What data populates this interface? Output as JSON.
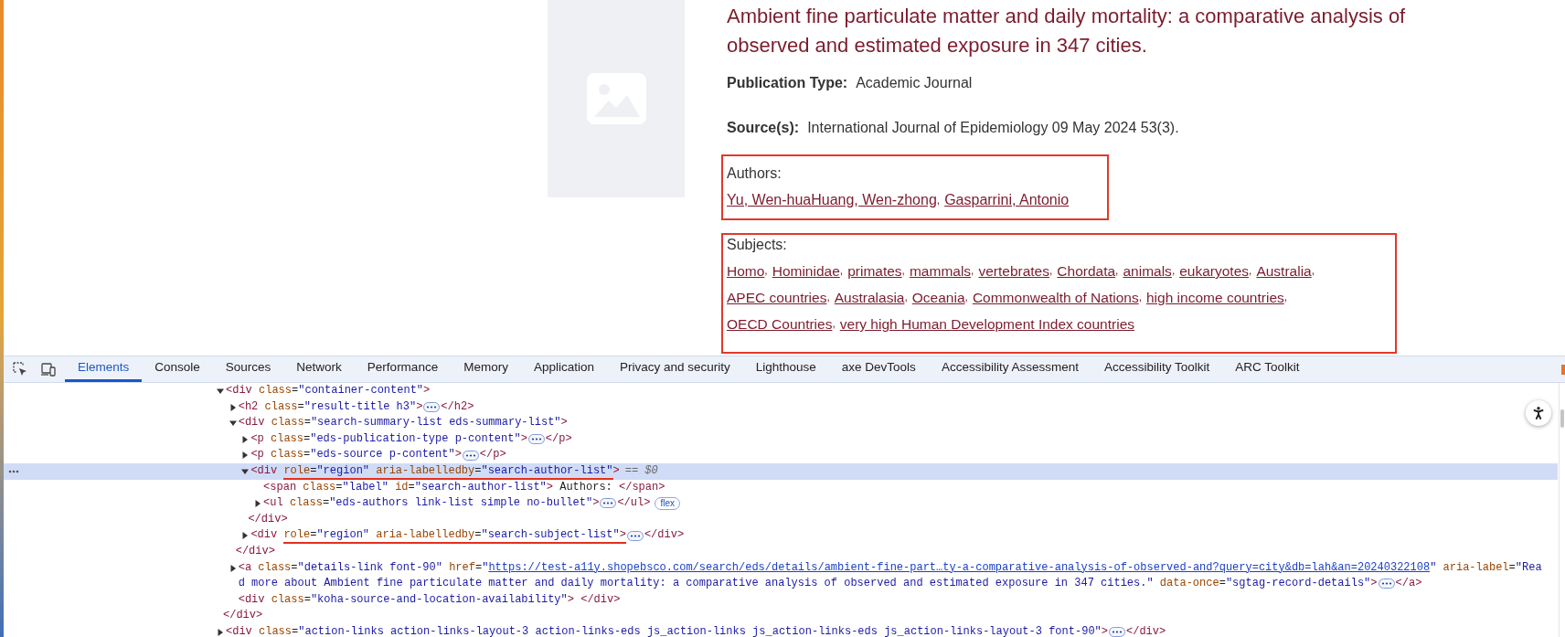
{
  "page": {
    "title": "Ambient fine particulate matter and daily mortality: a comparative analysis of observed and estimated exposure in 347 cities.",
    "fields": [
      {
        "label": "Publication Type:",
        "value": "Academic Journal"
      },
      {
        "label": "Source(s):",
        "value": "International Journal of Epidemiology 09 May 2024 53(3)."
      }
    ],
    "authors": {
      "label": "Authors:",
      "highlighted": true,
      "items": [
        {
          "name": "Yu, Wen-hua"
        },
        {
          "name": "Huang, Wen-zhong",
          "after": ","
        },
        {
          "name": "Gasparrini, Antonio"
        }
      ]
    },
    "subjects": {
      "label": "Subjects:",
      "highlighted": true,
      "items": [
        {
          "name": "Homo",
          "after": ","
        },
        {
          "name": "Hominidae",
          "after": ","
        },
        {
          "name": "primates",
          "after": ","
        },
        {
          "name": "mammals",
          "after": ","
        },
        {
          "name": "vertebrates",
          "after": ","
        },
        {
          "name": "Chordata",
          "after": ","
        },
        {
          "name": "animals",
          "after": ","
        },
        {
          "name": "eukaryotes",
          "after": ","
        },
        {
          "name": "Australia",
          "after": ","
        },
        {
          "name": "APEC countries",
          "after": ","
        },
        {
          "name": "Australasia",
          "after": ","
        },
        {
          "name": "Oceania",
          "after": ","
        },
        {
          "name": "Commonwealth of Nations",
          "after": ","
        },
        {
          "name": "high income countries",
          "after": ","
        },
        {
          "name": "OECD Countries",
          "after": ","
        },
        {
          "name": "very high Human Development Index countries"
        }
      ]
    }
  },
  "devtools": {
    "tabs": [
      {
        "label": "Elements",
        "selected": true
      },
      {
        "label": "Console",
        "selected": false
      },
      {
        "label": "Sources",
        "selected": false
      },
      {
        "label": "Network",
        "selected": false
      },
      {
        "label": "Performance",
        "selected": false
      },
      {
        "label": "Memory",
        "selected": false
      },
      {
        "label": "Application",
        "selected": false
      },
      {
        "label": "Privacy and security",
        "selected": false
      },
      {
        "label": "Lighthouse",
        "selected": false
      },
      {
        "label": "axe DevTools",
        "selected": false
      },
      {
        "label": "Accessibility Assessment",
        "selected": false
      },
      {
        "label": "Accessibility Toolkit",
        "selected": false
      },
      {
        "label": "ARC Toolkit",
        "selected": false
      }
    ],
    "elements_tree": [
      {
        "kind": "element",
        "tag": [
          {
            "kind": "code",
            "text": "<div class=\"container-content\">"
          }
        ],
        "expanded": true,
        "selected": false,
        "close": "</div>",
        "children": [
          {
            "kind": "element",
            "tag": [
              {
                "kind": "code",
                "text": "<h2 class=\"result-title h3\">"
              }
            ],
            "expanded": false,
            "selected": false,
            "end": "</h2>"
          },
          {
            "kind": "element",
            "tag": [
              {
                "kind": "code",
                "text": "<div class=\"search-summary-list eds-summary-list\">"
              }
            ],
            "expanded": true,
            "selected": false,
            "close": "</div>",
            "children": [
              {
                "kind": "element",
                "tag": [
                  {
                    "kind": "code",
                    "text": "<p class=\"eds-publication-type p-content\">"
                  }
                ],
                "expanded": false,
                "selected": false,
                "end": "</p>"
              },
              {
                "kind": "element",
                "tag": [
                  {
                    "kind": "code",
                    "text": "<p class=\"eds-source p-content\">"
                  }
                ],
                "expanded": false,
                "selected": false,
                "end": "</p>"
              },
              {
                "kind": "element",
                "tag": [
                  {
                    "kind": "code",
                    "text": "<div "
                  },
                  {
                    "kind": "marked",
                    "text": "role=\"region\" aria-labelledby=\"search-author-list\""
                  },
                  {
                    "kind": "code",
                    "text": ">"
                  }
                ],
                "expanded": true,
                "selected": true,
                "suffix": "== $0",
                "close": "</div>",
                "children": [
                  {
                    "kind": "leaf",
                    "tag": [
                      {
                        "kind": "code",
                        "text": "<span class=\"label\" id=\"search-author-list\"> Authors: </span>"
                      }
                    ],
                    "selected": false
                  },
                  {
                    "kind": "element",
                    "tag": [
                      {
                        "kind": "code",
                        "text": "<ul class=\"eds-authors link-list simple no-bullet\">"
                      }
                    ],
                    "expanded": false,
                    "selected": false,
                    "end": "</ul>",
                    "badge": "flex"
                  }
                ]
              },
              {
                "kind": "element",
                "tag": [
                  {
                    "kind": "code",
                    "text": "<div "
                  },
                  {
                    "kind": "marked",
                    "text": "role=\"region\" aria-labelledby=\"search-subject-list\">"
                  }
                ],
                "expanded": false,
                "selected": false,
                "end": "</div>"
              }
            ]
          },
          {
            "kind": "element",
            "tag": [
              {
                "kind": "code",
                "text": "<a class=\"details-link font-90\" href=\""
              },
              {
                "kind": "url",
                "text": "https://test-a11y.shopebsco.com/search/eds/details/ambient-fine-part…ty-a-comparative-analysis-of-observed-and?query=city&db=lah&an=20240322108"
              },
              {
                "kind": "code",
                "text": "\" aria-label=\"Rea"
              },
              {
                "kind": "wrap",
                "text": "d more about Ambient fine particulate matter and daily mortality: a comparative analysis of observed and estimated exposure in 347 cities.\" data-once=\"sgtag-record-details\">"
              }
            ],
            "expanded": false,
            "selected": false,
            "end": "</a>"
          },
          {
            "kind": "leaf",
            "tag": [
              {
                "kind": "code",
                "text": "<div class=\"koha-source-and-location-availability\"> </div>"
              }
            ],
            "selected": false
          }
        ]
      },
      {
        "kind": "element",
        "tag": [
          {
            "kind": "code",
            "text": "<div class=\"action-links action-links-layout-3 action-links-eds js_action-links js_action-links-eds js_action-links-layout-3 font-90\">"
          }
        ],
        "expanded": false,
        "selected": false,
        "end": "</div>"
      }
    ]
  }
}
